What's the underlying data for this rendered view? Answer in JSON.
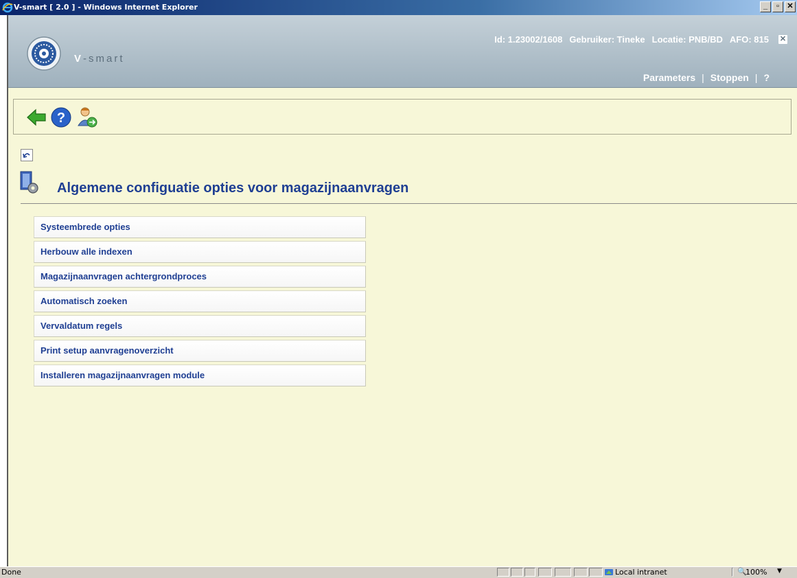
{
  "window": {
    "title": "V-smart [ 2.0 ] - Windows Internet Explorer",
    "minimize": "_",
    "maximize": "▫",
    "close": "✕"
  },
  "header": {
    "brand_prefix": "V",
    "brand_suffix": "-smart",
    "session": {
      "id": "Id: 1.23002/1608",
      "user": "Gebruiker: Tineke",
      "location": "Locatie: PNB/BD",
      "afo": "AFO: 815"
    },
    "nav": {
      "parameters": "Parameters",
      "stop": "Stoppen",
      "help": "?"
    }
  },
  "toolbar": {
    "back_icon": "back-arrow-icon",
    "help_icon": "help-question-icon",
    "user_icon": "user-switch-icon"
  },
  "page": {
    "title": "Algemene configuatie opties voor magazijnaanvragen",
    "menu": [
      "Systeembrede opties",
      "Herbouw alle indexen",
      "Magazijnaanvragen achtergrondproces",
      "Automatisch zoeken",
      "Vervaldatum regels",
      "Print setup aanvragenoverzicht",
      "Installeren magazijnaanvragen module"
    ]
  },
  "status": {
    "text": "Done",
    "zone": "Local intranet",
    "zoom": "100%"
  },
  "colors": {
    "accent": "#1f3f93",
    "background": "#f7f7d8",
    "header": "#9fb1bd"
  }
}
